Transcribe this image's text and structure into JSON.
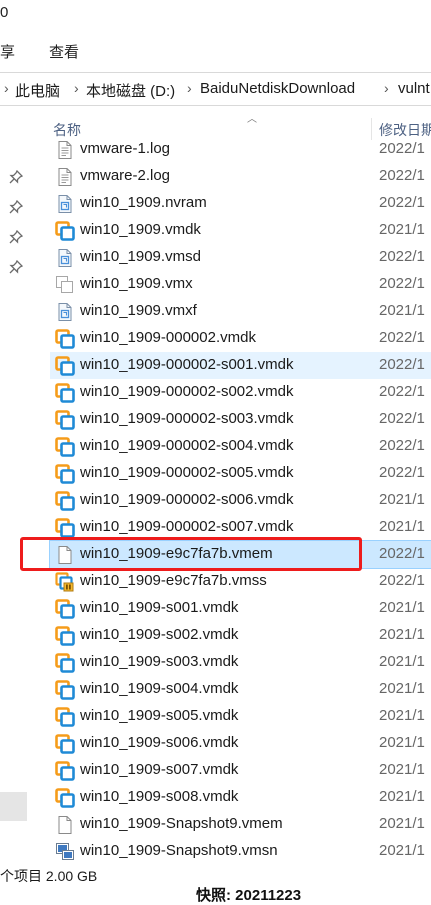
{
  "window": {
    "title_fragment": "0"
  },
  "menu": {
    "items": [
      "享",
      "查看"
    ]
  },
  "address": {
    "crumbs": [
      "此电脑",
      "本地磁盘 (D:)",
      "BaiduNetdiskDownload",
      "vulnt"
    ],
    "separator": "›"
  },
  "columns": {
    "name": "名称",
    "date": "修改日期"
  },
  "files": [
    {
      "name": "vmware-1.log",
      "date": "2022/1",
      "icon": "text-file-icon"
    },
    {
      "name": "vmware-2.log",
      "date": "2022/1",
      "icon": "text-file-icon"
    },
    {
      "name": "win10_1909.nvram",
      "date": "2022/1",
      "icon": "vmware-config-icon"
    },
    {
      "name": "win10_1909.vmdk",
      "date": "2021/1",
      "icon": "vmware-disk-icon"
    },
    {
      "name": "win10_1909.vmsd",
      "date": "2022/1",
      "icon": "vmware-config-icon"
    },
    {
      "name": "win10_1909.vmx",
      "date": "2022/1",
      "icon": "vmware-vmx-icon"
    },
    {
      "name": "win10_1909.vmxf",
      "date": "2021/1",
      "icon": "vmware-config-icon"
    },
    {
      "name": "win10_1909-000002.vmdk",
      "date": "2022/1",
      "icon": "vmware-disk-icon"
    },
    {
      "name": "win10_1909-000002-s001.vmdk",
      "date": "2022/1",
      "icon": "vmware-disk-icon"
    },
    {
      "name": "win10_1909-000002-s002.vmdk",
      "date": "2022/1",
      "icon": "vmware-disk-icon"
    },
    {
      "name": "win10_1909-000002-s003.vmdk",
      "date": "2022/1",
      "icon": "vmware-disk-icon"
    },
    {
      "name": "win10_1909-000002-s004.vmdk",
      "date": "2022/1",
      "icon": "vmware-disk-icon"
    },
    {
      "name": "win10_1909-000002-s005.vmdk",
      "date": "2022/1",
      "icon": "vmware-disk-icon"
    },
    {
      "name": "win10_1909-000002-s006.vmdk",
      "date": "2021/1",
      "icon": "vmware-disk-icon"
    },
    {
      "name": "win10_1909-000002-s007.vmdk",
      "date": "2021/1",
      "icon": "vmware-disk-icon"
    },
    {
      "name": "win10_1909-e9c7fa7b.vmem",
      "date": "2022/1",
      "icon": "blank-file-icon"
    },
    {
      "name": "win10_1909-e9c7fa7b.vmss",
      "date": "2022/1",
      "icon": "vmware-suspend-icon"
    },
    {
      "name": "win10_1909-s001.vmdk",
      "date": "2021/1",
      "icon": "vmware-disk-icon"
    },
    {
      "name": "win10_1909-s002.vmdk",
      "date": "2021/1",
      "icon": "vmware-disk-icon"
    },
    {
      "name": "win10_1909-s003.vmdk",
      "date": "2021/1",
      "icon": "vmware-disk-icon"
    },
    {
      "name": "win10_1909-s004.vmdk",
      "date": "2021/1",
      "icon": "vmware-disk-icon"
    },
    {
      "name": "win10_1909-s005.vmdk",
      "date": "2021/1",
      "icon": "vmware-disk-icon"
    },
    {
      "name": "win10_1909-s006.vmdk",
      "date": "2021/1",
      "icon": "vmware-disk-icon"
    },
    {
      "name": "win10_1909-s007.vmdk",
      "date": "2021/1",
      "icon": "vmware-disk-icon"
    },
    {
      "name": "win10_1909-s008.vmdk",
      "date": "2021/1",
      "icon": "vmware-disk-icon"
    },
    {
      "name": "win10_1909-Snapshot9.vmem",
      "date": "2021/1",
      "icon": "blank-file-icon"
    },
    {
      "name": "win10_1909-Snapshot9.vmsn",
      "date": "2021/1",
      "icon": "vmware-snapshot-icon"
    }
  ],
  "selected_index": 15,
  "hover_index": 8,
  "status": {
    "text": "个项目  2.00 GB"
  },
  "bottom_fragment": "快照:  20211223",
  "colors": {
    "highlight_box": "#ee1c1c",
    "selection": "#cce8ff",
    "hover": "#e5f3ff"
  }
}
